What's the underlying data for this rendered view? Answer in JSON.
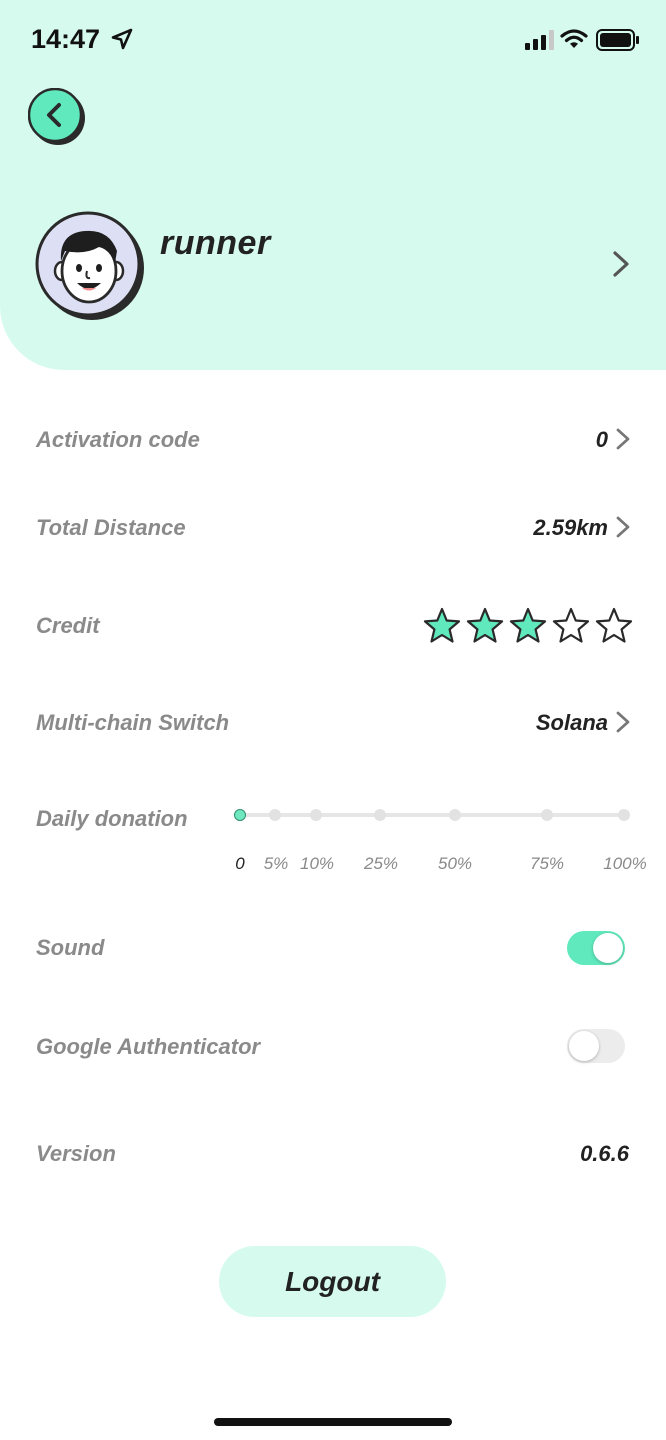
{
  "status_bar": {
    "time": "14:47"
  },
  "profile": {
    "username": "runner"
  },
  "settings": {
    "activation": {
      "label": "Activation code",
      "value": "0"
    },
    "distance": {
      "label": "Total Distance",
      "value": "2.59km"
    },
    "credit": {
      "label": "Credit",
      "rating": 3,
      "max": 5
    },
    "chain": {
      "label": "Multi-chain Switch",
      "value": "Solana"
    },
    "donation": {
      "label": "Daily donation",
      "selected": "0",
      "ticks": [
        "0",
        "5%",
        "10%",
        "25%",
        "50%",
        "75%",
        "100%"
      ]
    },
    "sound": {
      "label": "Sound",
      "on": true
    },
    "google_auth": {
      "label": "Google Authenticator",
      "on": false
    },
    "version": {
      "label": "Version",
      "value": "0.6.6"
    }
  },
  "logout_label": "Logout",
  "colors": {
    "accent": "#5fe9bc",
    "header_bg": "#d6fbee",
    "muted_text": "#8a8a8a"
  }
}
